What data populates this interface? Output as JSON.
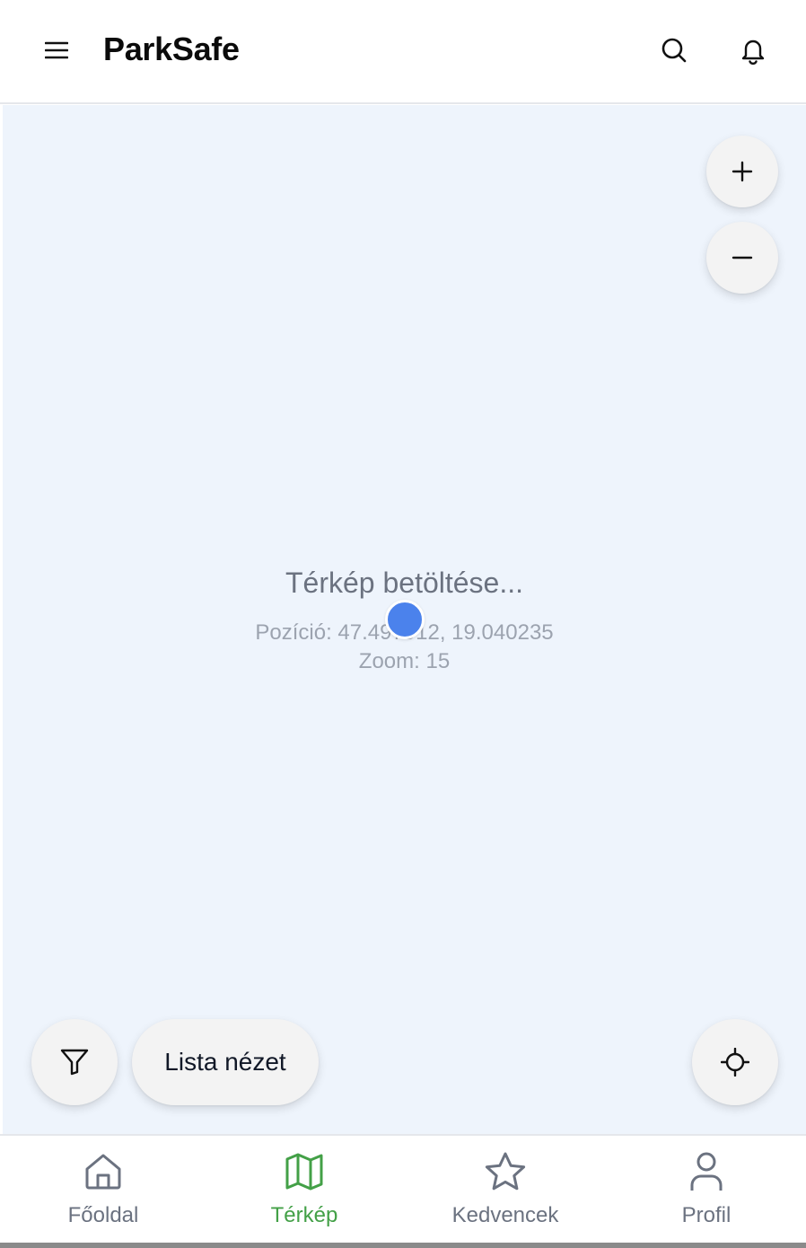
{
  "header": {
    "title": "ParkSafe",
    "menu_icon": "menu-icon",
    "search_icon": "search-icon",
    "bell_icon": "bell-icon"
  },
  "map": {
    "loading_title": "Térkép betöltése...",
    "position_text": "Pozíció: 47.497912, 19.040235",
    "zoom_text": "Zoom: 15",
    "zoom_in_icon": "plus-icon",
    "zoom_out_icon": "minus-icon",
    "filter_icon": "filter-icon",
    "list_view_label": "Lista nézet",
    "locate_icon": "crosshair-icon",
    "background_color": "#eef4fc",
    "location_dot_color": "#4b82ec"
  },
  "bottom_nav": {
    "items": [
      {
        "label": "Főoldal",
        "icon": "home-icon",
        "active": false
      },
      {
        "label": "Térkép",
        "icon": "map-icon",
        "active": true
      },
      {
        "label": "Kedvencek",
        "icon": "star-icon",
        "active": false
      },
      {
        "label": "Profil",
        "icon": "user-icon",
        "active": false
      }
    ],
    "active_color": "#43a047",
    "inactive_color": "#6b7280"
  }
}
